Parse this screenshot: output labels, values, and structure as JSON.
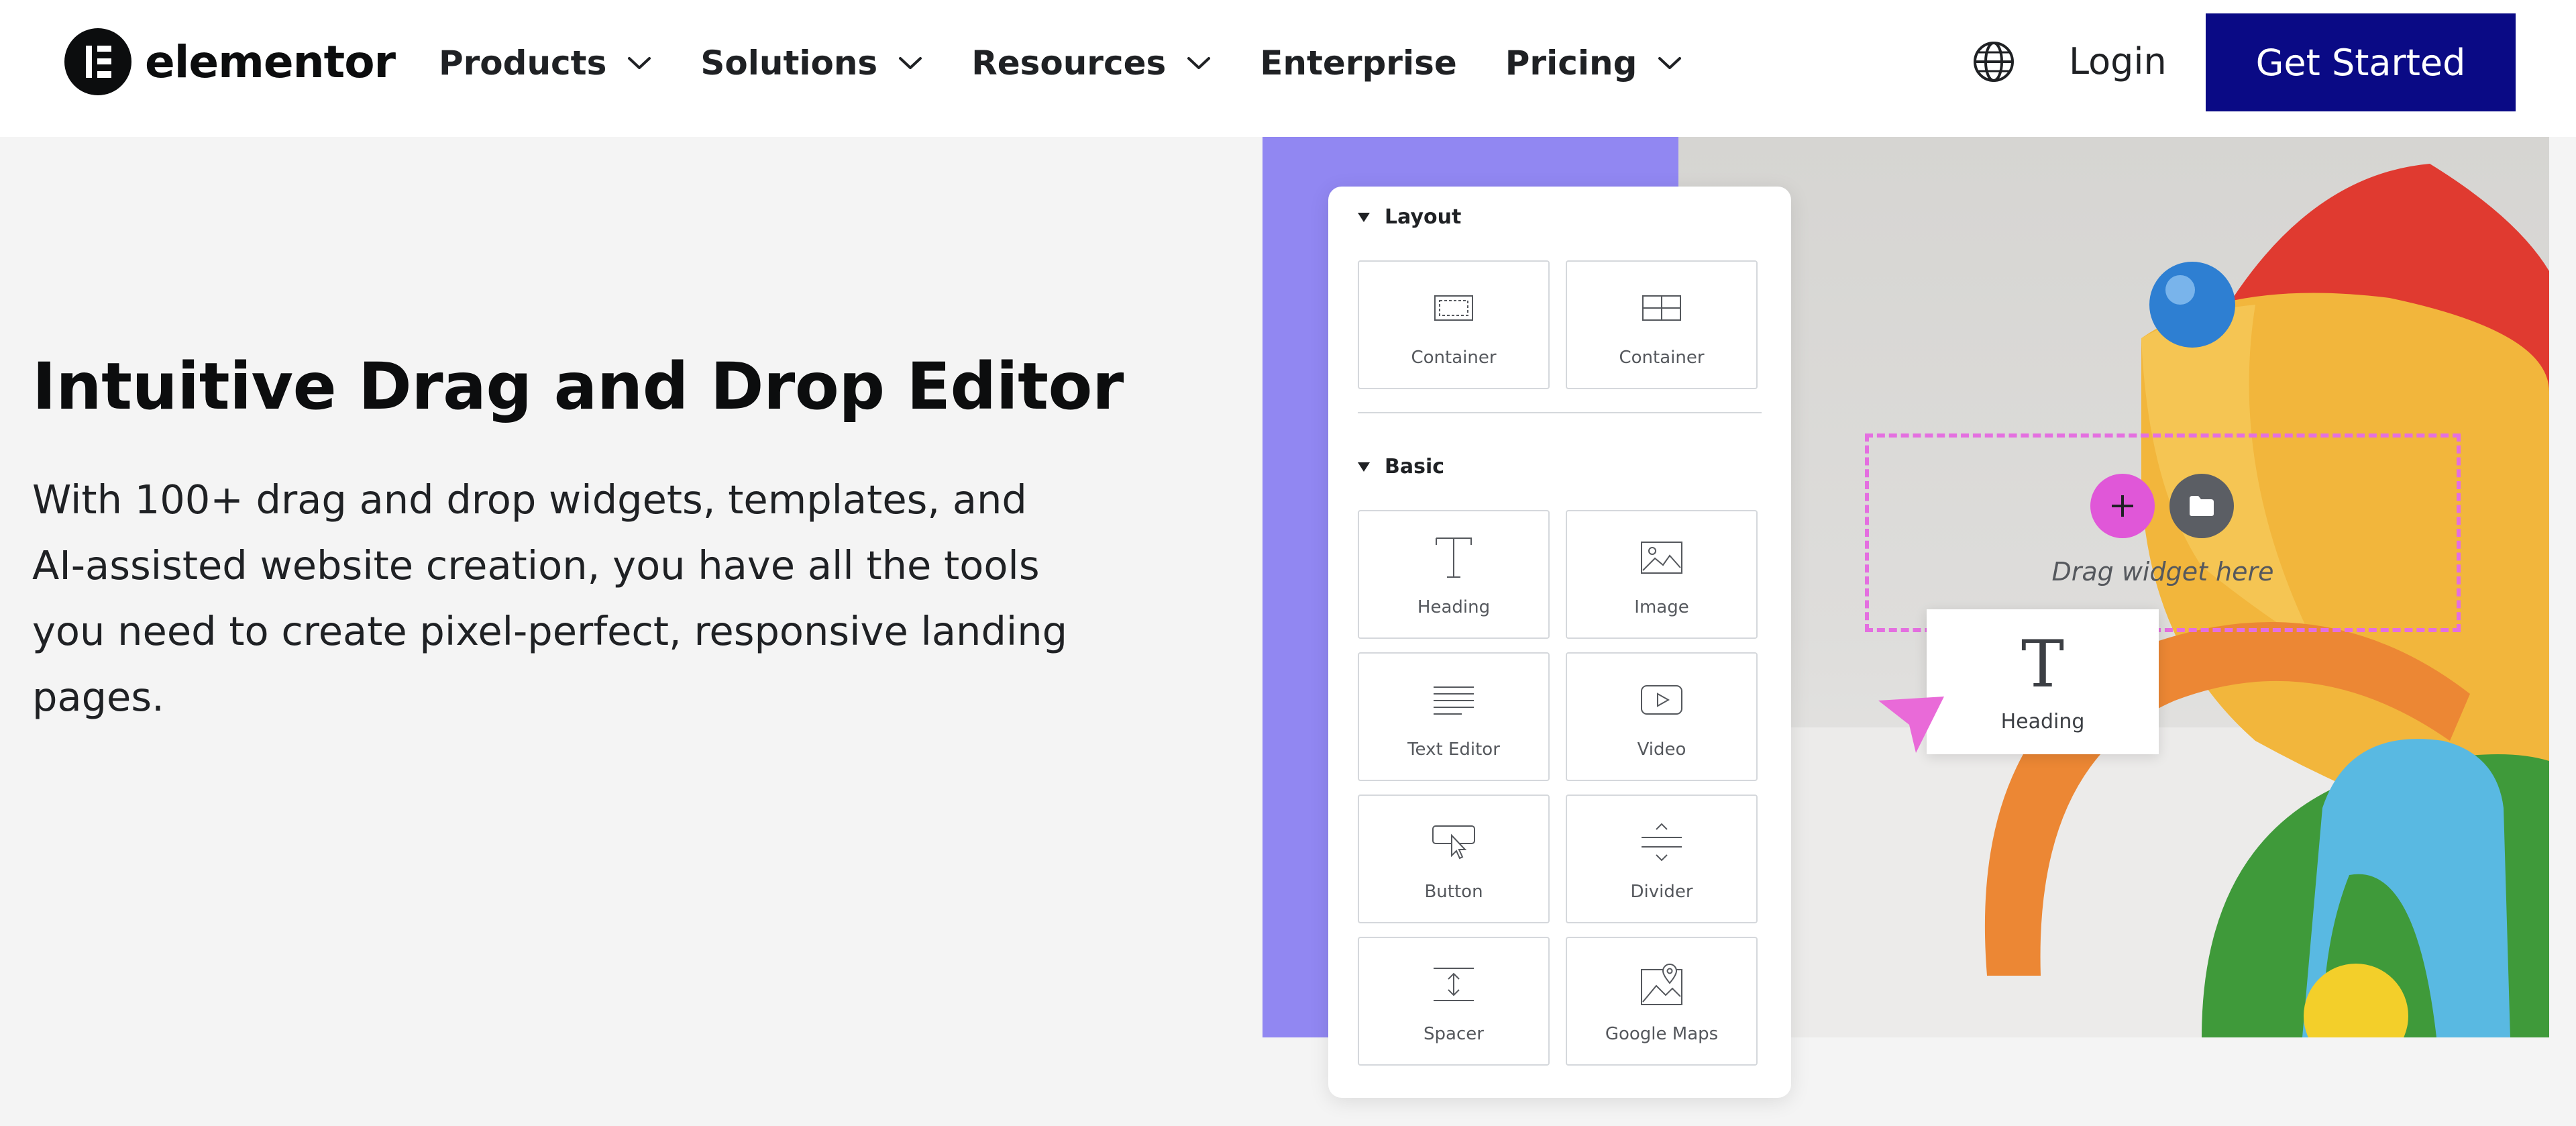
{
  "header": {
    "logo_text": "elementor",
    "nav": [
      {
        "label": "Products",
        "has_dropdown": true
      },
      {
        "label": "Solutions",
        "has_dropdown": true
      },
      {
        "label": "Resources",
        "has_dropdown": true
      },
      {
        "label": "Enterprise",
        "has_dropdown": false
      },
      {
        "label": "Pricing",
        "has_dropdown": true
      }
    ],
    "language_icon": "globe-icon",
    "login_label": "Login",
    "cta_label": "Get Started"
  },
  "hero": {
    "title": "Intuitive Drag and Drop Editor",
    "description": "With 100+ drag and drop widgets, templates, and AI-assisted website creation, you have all the tools you need to create pixel-perfect, responsive landing pages."
  },
  "panel": {
    "layout_heading": "Layout",
    "basic_heading": "Basic",
    "layout_widgets": [
      {
        "label": "Container",
        "icon": "container-icon"
      },
      {
        "label": "Container",
        "icon": "grid-container-icon"
      }
    ],
    "basic_widgets": [
      {
        "label": "Heading",
        "icon": "heading-icon"
      },
      {
        "label": "Image",
        "icon": "image-icon"
      },
      {
        "label": "Text Editor",
        "icon": "text-editor-icon"
      },
      {
        "label": "Video",
        "icon": "video-icon"
      },
      {
        "label": "Button",
        "icon": "button-icon"
      },
      {
        "label": "Divider",
        "icon": "divider-icon"
      },
      {
        "label": "Spacer",
        "icon": "spacer-icon"
      },
      {
        "label": "Google Maps",
        "icon": "google-maps-icon"
      }
    ]
  },
  "canvas": {
    "drop_text": "Drag widget here",
    "dragged_widget_label": "Heading",
    "dragged_widget_icon": "heading-icon"
  },
  "colors": {
    "cta": "#0a0a85",
    "panel_accent": "#9187f2",
    "drop_zone": "#e46fe0",
    "add_button": "#e057d8",
    "folder_button": "#5b5e64"
  }
}
